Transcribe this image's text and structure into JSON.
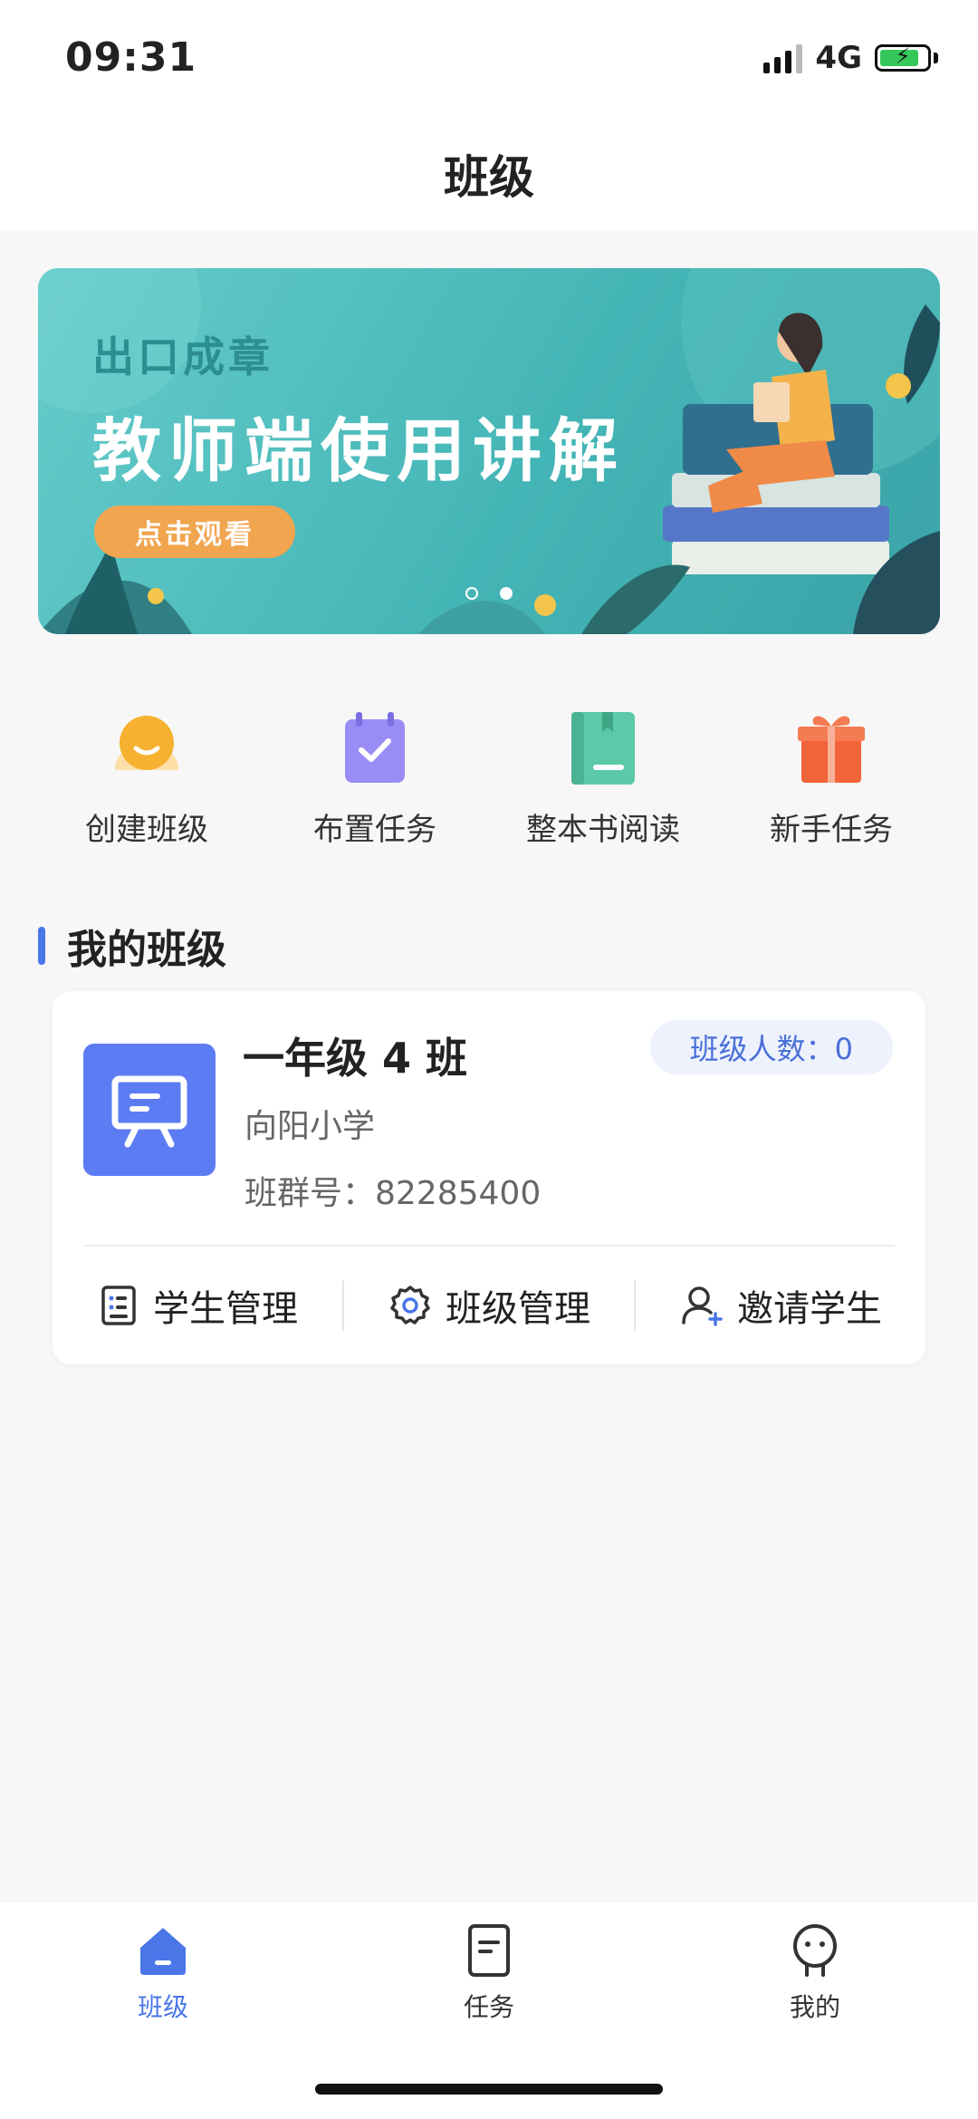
{
  "status_bar": {
    "time": "09:31",
    "network": "4G",
    "battery_level": 0.85
  },
  "header": {
    "title": "班级"
  },
  "banner": {
    "subtitle": "出口成章",
    "title": "教师端使用讲解",
    "button_label": "点击观看",
    "page_count": 2,
    "active_page": 2
  },
  "quick_actions": [
    {
      "label": "创建班级",
      "icon": "smiley-icon",
      "color": "#f5b12f"
    },
    {
      "label": "布置任务",
      "icon": "calendar-check-icon",
      "color": "#9a8cf5"
    },
    {
      "label": "整本书阅读",
      "icon": "book-icon",
      "color": "#5cc9a8"
    },
    {
      "label": "新手任务",
      "icon": "gift-icon",
      "color": "#f2643a"
    }
  ],
  "my_classes": {
    "title": "我的班级",
    "classes": [
      {
        "name": "一年级 4 班",
        "school": "向阳小学",
        "group_no": "班群号：82285400",
        "member_count": "班级人数：0",
        "actions": [
          {
            "label": "学生管理",
            "icon": "student-list-icon"
          },
          {
            "label": "班级管理",
            "icon": "settings-gear-icon"
          },
          {
            "label": "邀请学生",
            "icon": "add-user-icon"
          }
        ]
      }
    ]
  },
  "tab_bar": {
    "active_index": 0,
    "tabs": [
      {
        "label": "班级",
        "icon": "home-icon"
      },
      {
        "label": "任务",
        "icon": "task-doc-icon"
      },
      {
        "label": "我的",
        "icon": "profile-face-icon"
      }
    ]
  },
  "colors": {
    "accent": "#4a76e8",
    "banner_teal": "#44b5b6",
    "banner_button": "#f2a54f",
    "background": "#f7f7f8"
  }
}
